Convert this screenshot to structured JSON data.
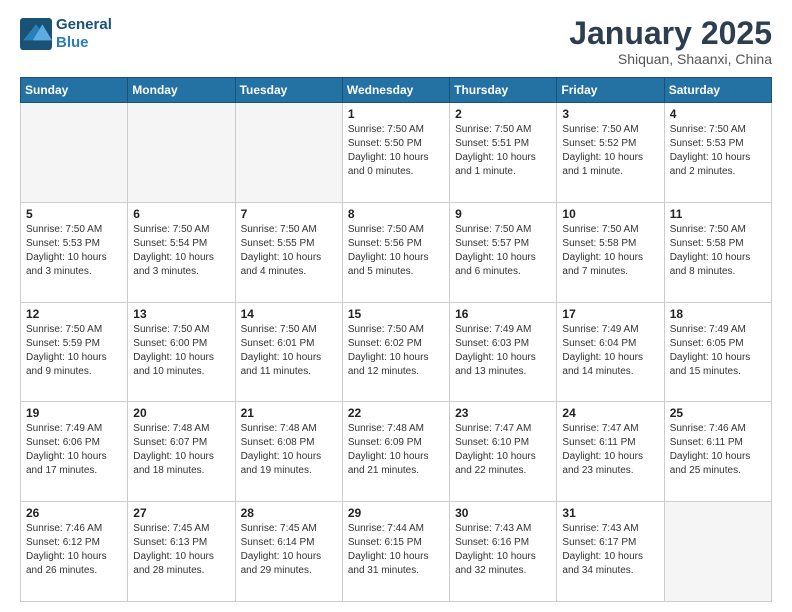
{
  "logo": {
    "line1": "General",
    "line2": "Blue"
  },
  "title": "January 2025",
  "subtitle": "Shiquan, Shaanxi, China",
  "weekdays": [
    "Sunday",
    "Monday",
    "Tuesday",
    "Wednesday",
    "Thursday",
    "Friday",
    "Saturday"
  ],
  "weeks": [
    [
      {
        "day": "",
        "info": ""
      },
      {
        "day": "",
        "info": ""
      },
      {
        "day": "",
        "info": ""
      },
      {
        "day": "1",
        "info": "Sunrise: 7:50 AM\nSunset: 5:50 PM\nDaylight: 10 hours\nand 0 minutes."
      },
      {
        "day": "2",
        "info": "Sunrise: 7:50 AM\nSunset: 5:51 PM\nDaylight: 10 hours\nand 1 minute."
      },
      {
        "day": "3",
        "info": "Sunrise: 7:50 AM\nSunset: 5:52 PM\nDaylight: 10 hours\nand 1 minute."
      },
      {
        "day": "4",
        "info": "Sunrise: 7:50 AM\nSunset: 5:53 PM\nDaylight: 10 hours\nand 2 minutes."
      }
    ],
    [
      {
        "day": "5",
        "info": "Sunrise: 7:50 AM\nSunset: 5:53 PM\nDaylight: 10 hours\nand 3 minutes."
      },
      {
        "day": "6",
        "info": "Sunrise: 7:50 AM\nSunset: 5:54 PM\nDaylight: 10 hours\nand 3 minutes."
      },
      {
        "day": "7",
        "info": "Sunrise: 7:50 AM\nSunset: 5:55 PM\nDaylight: 10 hours\nand 4 minutes."
      },
      {
        "day": "8",
        "info": "Sunrise: 7:50 AM\nSunset: 5:56 PM\nDaylight: 10 hours\nand 5 minutes."
      },
      {
        "day": "9",
        "info": "Sunrise: 7:50 AM\nSunset: 5:57 PM\nDaylight: 10 hours\nand 6 minutes."
      },
      {
        "day": "10",
        "info": "Sunrise: 7:50 AM\nSunset: 5:58 PM\nDaylight: 10 hours\nand 7 minutes."
      },
      {
        "day": "11",
        "info": "Sunrise: 7:50 AM\nSunset: 5:58 PM\nDaylight: 10 hours\nand 8 minutes."
      }
    ],
    [
      {
        "day": "12",
        "info": "Sunrise: 7:50 AM\nSunset: 5:59 PM\nDaylight: 10 hours\nand 9 minutes."
      },
      {
        "day": "13",
        "info": "Sunrise: 7:50 AM\nSunset: 6:00 PM\nDaylight: 10 hours\nand 10 minutes."
      },
      {
        "day": "14",
        "info": "Sunrise: 7:50 AM\nSunset: 6:01 PM\nDaylight: 10 hours\nand 11 minutes."
      },
      {
        "day": "15",
        "info": "Sunrise: 7:50 AM\nSunset: 6:02 PM\nDaylight: 10 hours\nand 12 minutes."
      },
      {
        "day": "16",
        "info": "Sunrise: 7:49 AM\nSunset: 6:03 PM\nDaylight: 10 hours\nand 13 minutes."
      },
      {
        "day": "17",
        "info": "Sunrise: 7:49 AM\nSunset: 6:04 PM\nDaylight: 10 hours\nand 14 minutes."
      },
      {
        "day": "18",
        "info": "Sunrise: 7:49 AM\nSunset: 6:05 PM\nDaylight: 10 hours\nand 15 minutes."
      }
    ],
    [
      {
        "day": "19",
        "info": "Sunrise: 7:49 AM\nSunset: 6:06 PM\nDaylight: 10 hours\nand 17 minutes."
      },
      {
        "day": "20",
        "info": "Sunrise: 7:48 AM\nSunset: 6:07 PM\nDaylight: 10 hours\nand 18 minutes."
      },
      {
        "day": "21",
        "info": "Sunrise: 7:48 AM\nSunset: 6:08 PM\nDaylight: 10 hours\nand 19 minutes."
      },
      {
        "day": "22",
        "info": "Sunrise: 7:48 AM\nSunset: 6:09 PM\nDaylight: 10 hours\nand 21 minutes."
      },
      {
        "day": "23",
        "info": "Sunrise: 7:47 AM\nSunset: 6:10 PM\nDaylight: 10 hours\nand 22 minutes."
      },
      {
        "day": "24",
        "info": "Sunrise: 7:47 AM\nSunset: 6:11 PM\nDaylight: 10 hours\nand 23 minutes."
      },
      {
        "day": "25",
        "info": "Sunrise: 7:46 AM\nSunset: 6:11 PM\nDaylight: 10 hours\nand 25 minutes."
      }
    ],
    [
      {
        "day": "26",
        "info": "Sunrise: 7:46 AM\nSunset: 6:12 PM\nDaylight: 10 hours\nand 26 minutes."
      },
      {
        "day": "27",
        "info": "Sunrise: 7:45 AM\nSunset: 6:13 PM\nDaylight: 10 hours\nand 28 minutes."
      },
      {
        "day": "28",
        "info": "Sunrise: 7:45 AM\nSunset: 6:14 PM\nDaylight: 10 hours\nand 29 minutes."
      },
      {
        "day": "29",
        "info": "Sunrise: 7:44 AM\nSunset: 6:15 PM\nDaylight: 10 hours\nand 31 minutes."
      },
      {
        "day": "30",
        "info": "Sunrise: 7:43 AM\nSunset: 6:16 PM\nDaylight: 10 hours\nand 32 minutes."
      },
      {
        "day": "31",
        "info": "Sunrise: 7:43 AM\nSunset: 6:17 PM\nDaylight: 10 hours\nand 34 minutes."
      },
      {
        "day": "",
        "info": ""
      }
    ]
  ]
}
